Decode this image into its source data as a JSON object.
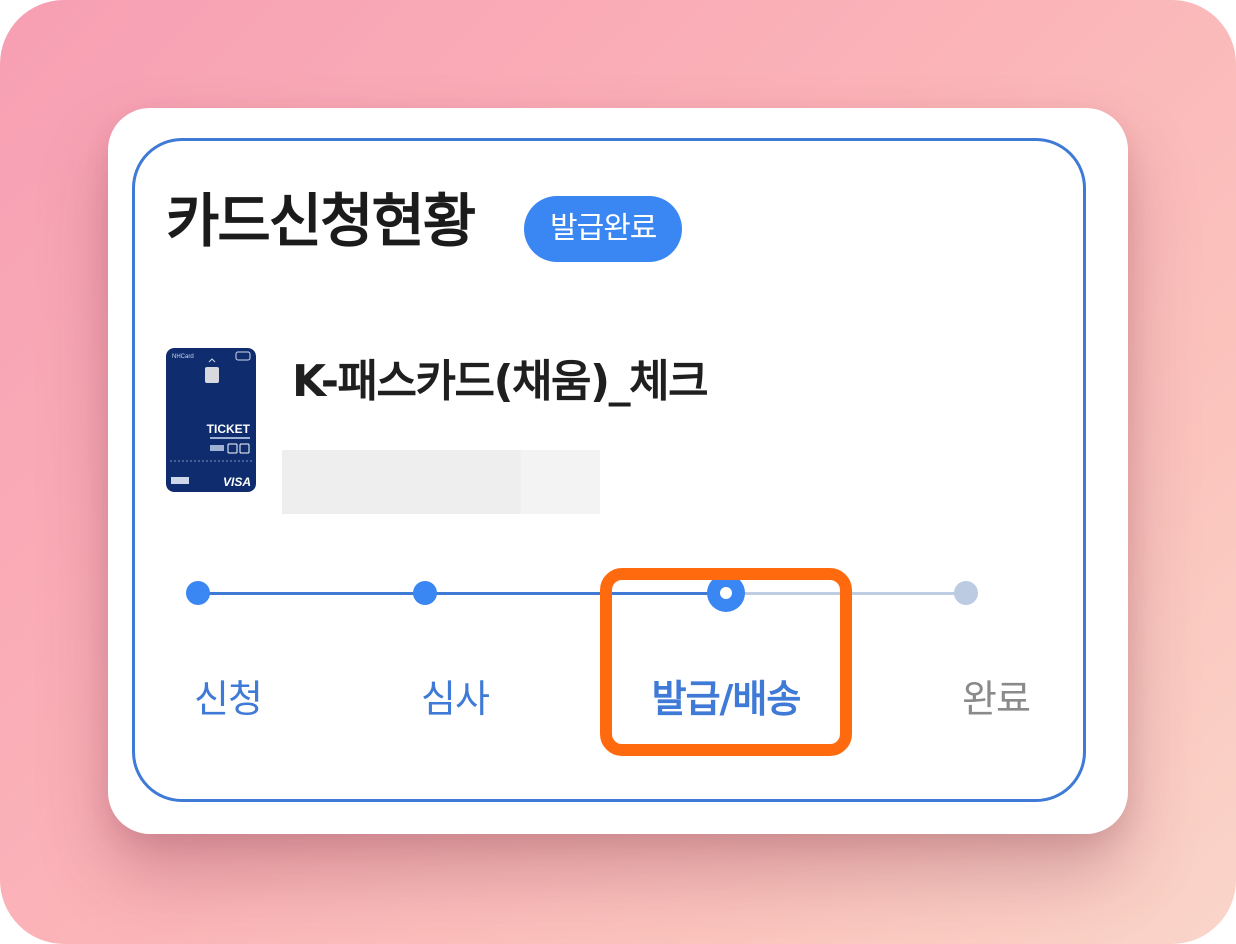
{
  "header": {
    "title": "카드신청현황",
    "status_badge": "발급완료"
  },
  "card": {
    "name": "K-패스카드(채움)_체크",
    "image_text": {
      "ticket": "TICKET",
      "network": "VISA",
      "issuer": "NHCard"
    },
    "card_color": "#0f2d6e"
  },
  "progress": {
    "steps": [
      {
        "label": "신청",
        "state": "done"
      },
      {
        "label": "심사",
        "state": "done"
      },
      {
        "label": "발급/배송",
        "state": "current"
      },
      {
        "label": "완료",
        "state": "todo"
      }
    ],
    "highlighted_step": "발급/배송"
  },
  "colors": {
    "accent": "#3a86f2",
    "highlight": "#ff6a0e",
    "inactive": "#bccbe2",
    "background_gradient": [
      "#f79fb4",
      "#fad5c9"
    ]
  }
}
